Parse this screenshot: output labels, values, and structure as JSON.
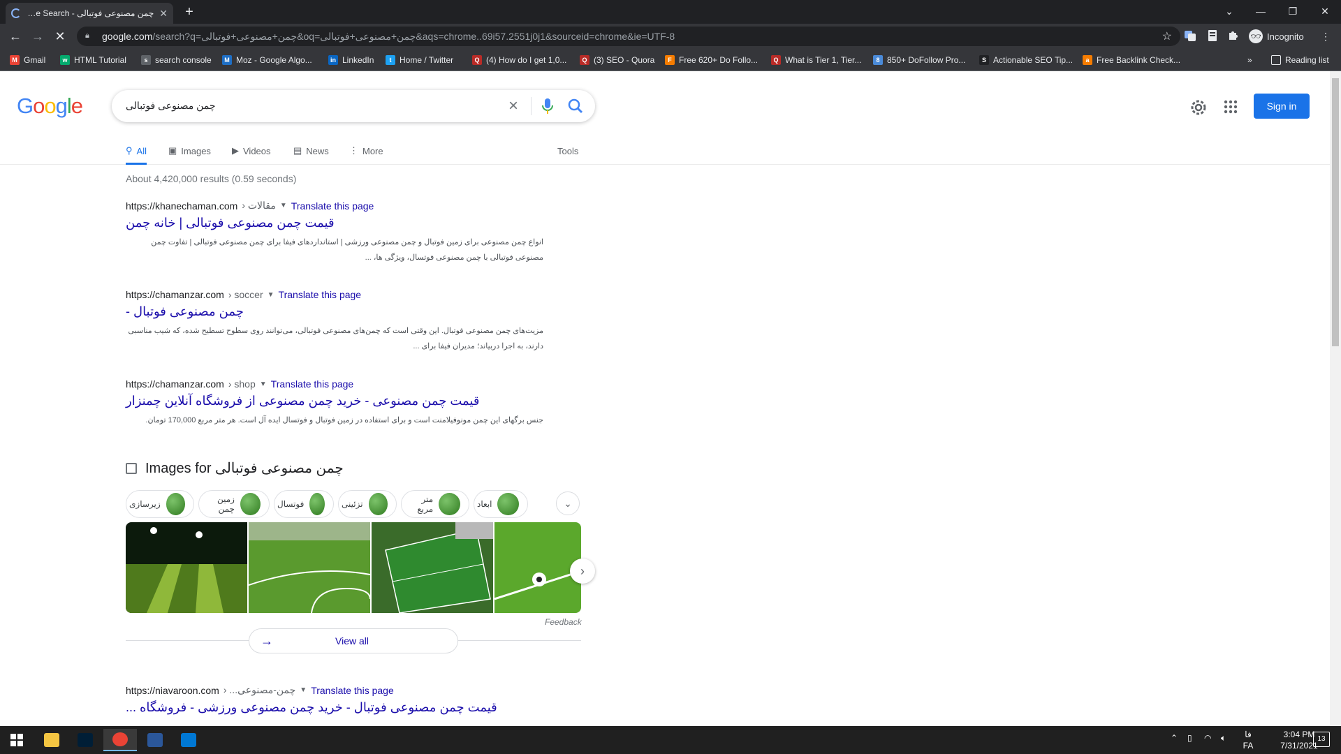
{
  "browser": {
    "tab_title": "چمن مصنوعی فوتبالی - Google Search",
    "new_tab_symbol": "+",
    "url_host": "google.com",
    "url_path": "/search?q=چمن+مصنوعی+فوتبالی&oq=چمن+مصنوعی+فوتبالی&aqs=chrome..69i57.2551j0j1&sourceid=chrome&ie=UTF-8",
    "incognito_label": "Incognito",
    "bookmarks": [
      {
        "label": "Gmail",
        "icon": "gmail-icon",
        "color": "#ea4335",
        "glyph": "M"
      },
      {
        "label": "HTML Tutorial",
        "icon": "w3schools-icon",
        "color": "#04aa6d",
        "glyph": "w"
      },
      {
        "label": "search console",
        "icon": "search-console-icon",
        "color": "#5f6368",
        "glyph": "s"
      },
      {
        "label": "Moz - Google Algo...",
        "icon": "moz-icon",
        "color": "#1f6fc5",
        "glyph": "M"
      },
      {
        "label": "LinkedIn",
        "icon": "linkedin-icon",
        "color": "#0a66c2",
        "glyph": "in"
      },
      {
        "label": "Home / Twitter",
        "icon": "twitter-icon",
        "color": "#1da1f2",
        "glyph": "t"
      },
      {
        "label": "(4) How do I get 1,0...",
        "icon": "quora-icon",
        "color": "#b92b27",
        "glyph": "Q"
      },
      {
        "label": "(3) SEO - Quora",
        "icon": "quora-icon",
        "color": "#b92b27",
        "glyph": "Q"
      },
      {
        "label": "Free 620+ Do Follo...",
        "icon": "site-icon",
        "color": "#f57c00",
        "glyph": "F"
      },
      {
        "label": "What is Tier 1, Tier...",
        "icon": "quora-icon",
        "color": "#b92b27",
        "glyph": "Q"
      },
      {
        "label": "850+ DoFollow Pro...",
        "icon": "cloud-icon",
        "color": "#4a8ad8",
        "glyph": "8"
      },
      {
        "label": "Actionable SEO Tip...",
        "icon": "seo-icon",
        "color": "#202124",
        "glyph": "S"
      },
      {
        "label": "Free Backlink Check...",
        "icon": "ahrefs-icon",
        "color": "#f57c00",
        "glyph": "a"
      }
    ],
    "bookmarks_overflow": "»",
    "reading_list": "Reading list"
  },
  "google": {
    "logo_letters": [
      "G",
      "o",
      "o",
      "g",
      "l",
      "e"
    ],
    "query": "چمن مصنوعی فوتبالی",
    "sign_in": "Sign in",
    "tabs": [
      {
        "label": "All",
        "icon": "search-icon",
        "active": true
      },
      {
        "label": "Images",
        "icon": "image-icon",
        "active": false
      },
      {
        "label": "Videos",
        "icon": "video-icon",
        "active": false
      },
      {
        "label": "News",
        "icon": "news-icon",
        "active": false
      },
      {
        "label": "More",
        "icon": "more-vert-icon",
        "active": false
      }
    ],
    "tools": "Tools",
    "stats": "About 4,420,000 results (0.59 seconds)",
    "results": [
      {
        "url": "https://khanechaman.com",
        "breadcrumb": "› مقالات",
        "translate": "Translate this page",
        "title": "قیمت چمن مصنوعی فوتبالی | خانه چمن",
        "snippet": "انواع چمن مصنوعی برای زمین فوتبال و چمن مصنوعی ورزشی | استانداردهای فیفا برای چمن مصنوعی فوتبالی | تفاوت چمن مصنوعی فوتبالی با چمن مصنوعی فوتسال، ویژگی ها، ..."
      },
      {
        "url": "https://chamanzar.com",
        "breadcrumb": "› soccer",
        "translate": "Translate this page",
        "title": "چمن مصنوعی فوتبال -",
        "snippet": "مزیت‌های چمن مصنوعی فوتبال. این وقتی است که چمن‌های مصنوعی فوتبالی، می‌توانند روی سطوح تسطیح شده، که شیب مناسبی دارند، به اجرا دربیاند؛ مدیران فیفا برای ..."
      },
      {
        "url": "https://chamanzar.com",
        "breadcrumb": "› shop",
        "translate": "Translate this page",
        "title": "قیمت چمن مصنوعی - خرید چمن مصنوعی از فروشگاه آنلاین چمنزار",
        "snippet": "جنس برگهای این چمن مونوفیلامنت است و برای استفاده در زمین فوتبال و فوتسال ایده آل است. هر متر مربع 170,000 تومان."
      },
      {
        "url": "https://niavaroon.com",
        "breadcrumb": "› ...چمن-مصنوعی",
        "translate": "Translate this page",
        "title": "قیمت چمن مصنوعی فوتبال - خرید چمن مصنوعی ورزشی - فروشگاه ...",
        "snippet": ""
      }
    ],
    "images_section": {
      "heading": "Images for چمن مصنوعی فوتبالی",
      "chips": [
        "زیرسازی",
        "زمین چمن",
        "فوتسال",
        "تزئینی",
        "متر مربع",
        "ابعاد"
      ],
      "feedback": "Feedback",
      "view_all": "View all"
    }
  },
  "taskbar": {
    "apps": [
      {
        "name": "file-explorer-icon",
        "color": "#f4c542"
      },
      {
        "name": "photoshop-icon",
        "color": "#001e36"
      },
      {
        "name": "chrome-icon",
        "color": "#ea4335"
      },
      {
        "name": "word-icon",
        "color": "#2b579a"
      },
      {
        "name": "photos-icon",
        "color": "#0078d4"
      }
    ],
    "lang_top": "فا",
    "lang_bottom": "FA",
    "time": "3:04 PM",
    "date": "7/31/2021",
    "notifications": "13"
  }
}
